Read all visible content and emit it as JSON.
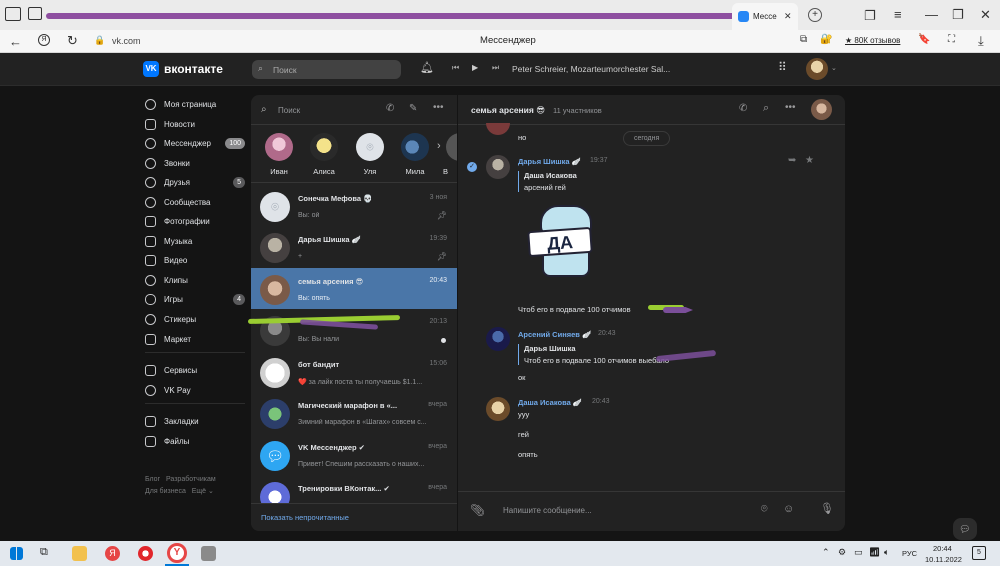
{
  "browser": {
    "active_tab_title": "Мессе",
    "url": "vk.com",
    "reviews_label": "★ 80К отзывов"
  },
  "header": {
    "logo": "вконтакте",
    "search_placeholder": "Поиск",
    "player_track": "Peter Schreier, Mozarteumorchester Sal..."
  },
  "nav": {
    "items": [
      {
        "label": "Моя страница"
      },
      {
        "label": "Новости"
      },
      {
        "label": "Мессенджер",
        "badge": "100"
      },
      {
        "label": "Звонки"
      },
      {
        "label": "Друзья",
        "badge": "5"
      },
      {
        "label": "Сообщества"
      },
      {
        "label": "Фотографии"
      },
      {
        "label": "Музыка"
      },
      {
        "label": "Видео"
      },
      {
        "label": "Клипы"
      },
      {
        "label": "Игры",
        "badge": "4"
      },
      {
        "label": "Стикеры"
      },
      {
        "label": "Маркет"
      },
      {
        "label": "Сервисы"
      },
      {
        "label": "VK Pay"
      },
      {
        "label": "Закладки"
      },
      {
        "label": "Файлы"
      }
    ],
    "footer": {
      "blog": "Блог",
      "developers": "Разработчикам",
      "business": "Для бизнеса",
      "more": "Ещё ⌄"
    }
  },
  "chatlist": {
    "search_placeholder": "Поиск",
    "stories": [
      {
        "name": "Иван"
      },
      {
        "name": "Алиса"
      },
      {
        "name": "Уля"
      },
      {
        "name": "Мила"
      },
      {
        "name": "В"
      }
    ],
    "chats": [
      {
        "name": "Сонечка Мефова 💀",
        "time": "3 ноя",
        "preview": "Вы: ой"
      },
      {
        "name": "Дарья Шишка 🪽",
        "time": "19:39",
        "preview": "+"
      },
      {
        "name": "семья арсения 😎",
        "time": "20:43",
        "preview": "Вы: опять"
      },
      {
        "name": "",
        "time": "20:13",
        "preview": "Вы: Вы нали"
      },
      {
        "name": "бот бандит",
        "time": "15:06",
        "preview": "❤️ за лайк поста ты получаешь $1.1..."
      },
      {
        "name": "Магический марафон в «...",
        "time": "вчера",
        "preview": "Зимний марафон в «Шагах» совсем с..."
      },
      {
        "name": "VK Мессенджер ✔",
        "time": "вчера",
        "preview": "Привет! Спешим рассказать о наших..."
      },
      {
        "name": "Тренировки ВКонтак... ✔",
        "time": "вчера",
        "preview": ""
      }
    ],
    "show_unread": "Показать непрочитанные"
  },
  "chat": {
    "title": "семья арсения 😎",
    "members": "11 участников",
    "date_divider": "сегодня",
    "top_partial_text": "но",
    "messages": [
      {
        "author": "Дарья Шишка 🪽",
        "time": "19:37",
        "quote_author": "Даша Исакова",
        "quote_text": "арсений гей",
        "sticker_text": "ДА",
        "text": "Чтоб его в подвале 100 отчимов"
      },
      {
        "author": "Арсений Синяев 🪽",
        "time": "20:43",
        "quote_author": "Дарья Шишка",
        "quote_text": "Чтоб его в подвале 100 отчимов выебало",
        "text": "ок"
      },
      {
        "author": "Даша Исакова 🪽",
        "time": "20:43",
        "lines": [
          "ууу",
          "гей",
          "опять"
        ]
      }
    ],
    "composer_placeholder": "Напишите сообщение..."
  },
  "taskbar": {
    "lang": "РУС",
    "time": "20:44",
    "date": "10.11.2022",
    "notif_count": "5"
  },
  "colors": {
    "accent": "#4a76a8",
    "link": "#71aaeb",
    "background": "#141414",
    "panel": "#222222"
  }
}
